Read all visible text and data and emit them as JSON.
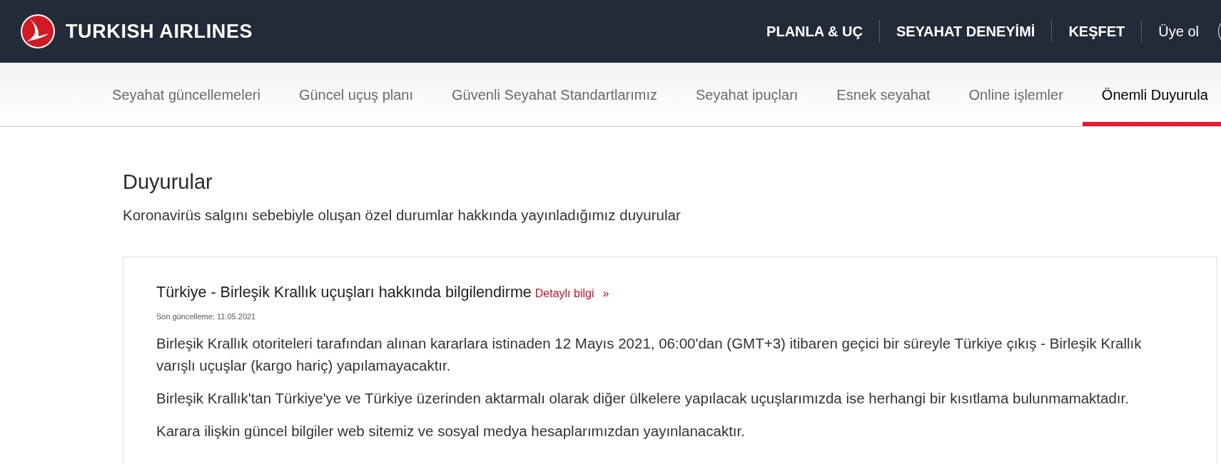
{
  "header": {
    "brand": "TURKISH AIRLINES",
    "nav": [
      {
        "label": "PLANLA & UÇ",
        "kind": "menu"
      },
      {
        "label": "SEYAHAT DENEYİMİ",
        "kind": "menu"
      },
      {
        "label": "KEŞFET",
        "kind": "menu"
      },
      {
        "label": "Üye ol",
        "kind": "link"
      }
    ]
  },
  "subnav": {
    "tabs": [
      {
        "label": "Seyahat güncellemeleri",
        "selected": false
      },
      {
        "label": "Güncel uçuş planı",
        "selected": false
      },
      {
        "label": "Güvenli Seyahat Standartlarımız",
        "selected": false
      },
      {
        "label": "Seyahat ipuçları",
        "selected": false
      },
      {
        "label": "Esnek seyahat",
        "selected": false
      },
      {
        "label": "Online işlemler",
        "selected": false
      },
      {
        "label": "Önemli Duyurula",
        "selected": true
      }
    ]
  },
  "page": {
    "title": "Duyurular",
    "subtitle": "Koronavirüs salgını sebebiyle oluşan özel durumlar hakkında yayınladığımız duyurular"
  },
  "announcements": [
    {
      "title": "Türkiye - Birleşik Krallık uçuşları hakkında bilgilendirme",
      "link": "Detaylı bilgi",
      "link_arrow": "»",
      "updated": "Son güncelleme: 11.05.2021",
      "paragraphs": [
        "Birleşik Krallık otoriteleri tarafından alınan kararlara istinaden 12 Mayıs 2021, 06:00'dan (GMT+3) itibaren geçici bir süreyle Türkiye çıkış - Birleşik Krallık varışlı uçuşlar (kargo hariç) yapılamayacaktır.",
        "Birleşik Krallık'tan Türkiye'ye ve Türkiye üzerinden aktarmalı olarak diğer ülkelere yapılacak uçuşlarımızda ise herhangi bir kısıtlama bulunmamaktadır.",
        "Karara ilişkin güncel bilgiler web sitemiz ve sosyal medya hesaplarımızdan yayınlanacaktır."
      ]
    }
  ]
}
